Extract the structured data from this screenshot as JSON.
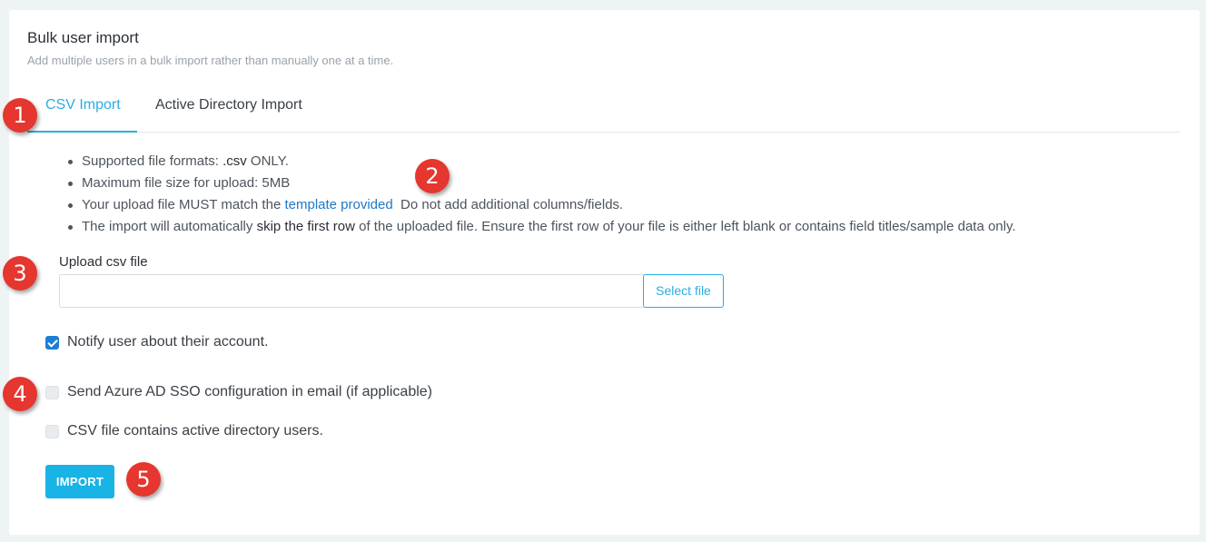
{
  "header": {
    "title": "Bulk user import",
    "subtitle": "Add multiple users in a bulk import rather than manually one at a time."
  },
  "tabs": [
    {
      "label": "CSV Import",
      "active": true
    },
    {
      "label": "Active Directory Import",
      "active": false
    }
  ],
  "rules": {
    "r1_text": "Supported file formats: ",
    "r1_strong": ".csv",
    "r1_tail": " ONLY.",
    "r2_text": "Maximum file size for upload: 5MB",
    "r3_text": "Your upload file MUST match the ",
    "r3_link": "template provided",
    "r3_tail": "  Do not add additional columns/fields.",
    "r4_text": "The import will automatically ",
    "r4_strong": "skip the first row",
    "r4_tail": " of the uploaded file. Ensure the first row of your file is either left blank or contains field titles/sample data only."
  },
  "upload": {
    "label": "Upload csv file",
    "value": "",
    "select_label": "Select file"
  },
  "options": {
    "notify": {
      "label": "Notify user about their account.",
      "checked": true
    },
    "azure": {
      "label": "Send Azure AD SSO configuration in email (if applicable)",
      "checked": false
    },
    "active_directory": {
      "label": "CSV file contains active directory users.",
      "checked": false
    }
  },
  "actions": {
    "import_label": "IMPORT"
  },
  "markers": {
    "m1": "1",
    "m2": "2",
    "m3": "3",
    "m4": "4",
    "m5": "5"
  },
  "colors": {
    "accent": "#29aee0",
    "button": "#19b3e6",
    "link": "#1f78c8",
    "checkbox": "#1e7ed6",
    "marker": "#e5362f"
  }
}
